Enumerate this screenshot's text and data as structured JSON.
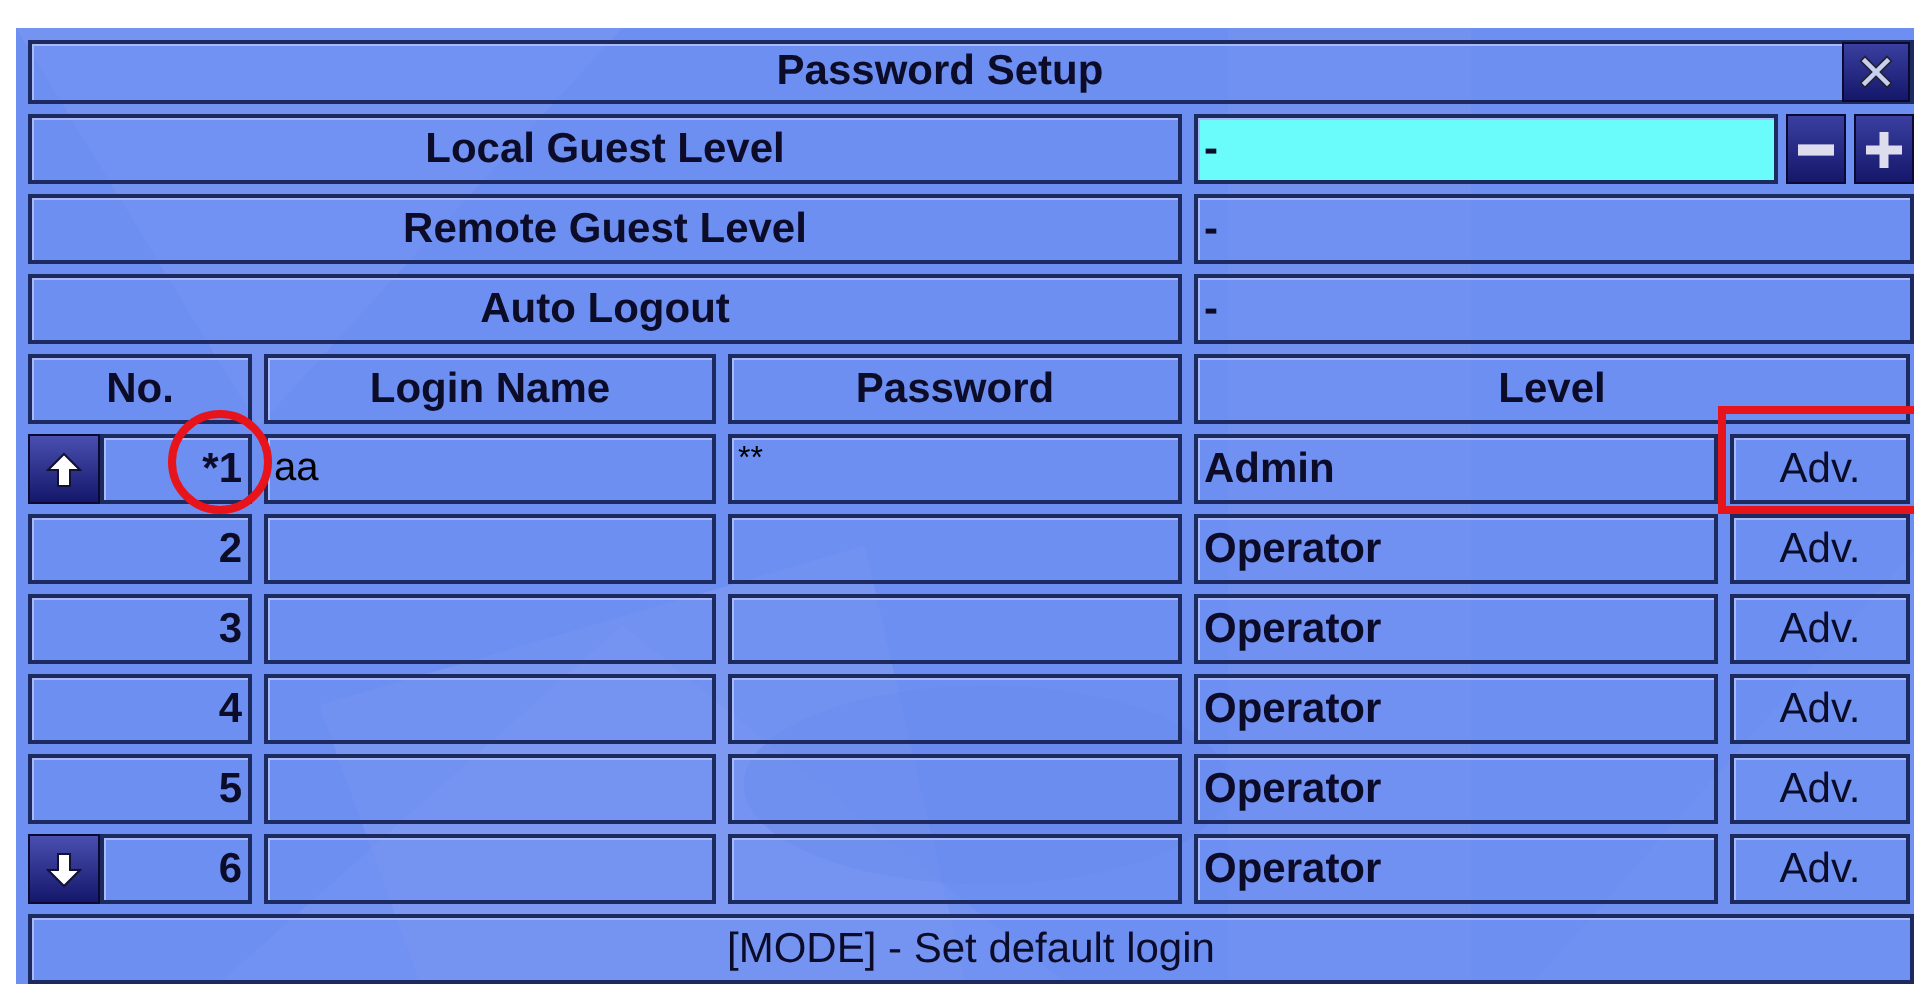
{
  "window": {
    "title": "Password Setup"
  },
  "settings": [
    {
      "label": "Local Guest Level",
      "value": "-",
      "selected": true
    },
    {
      "label": "Remote Guest Level",
      "value": "-",
      "selected": false
    },
    {
      "label": "Auto Logout",
      "value": "-",
      "selected": false
    }
  ],
  "table": {
    "columns": [
      "No.",
      "Login Name",
      "Password",
      "Level"
    ],
    "rows": [
      {
        "no": "*1",
        "login": "aa",
        "password": "**",
        "level": "Admin",
        "action": "Adv.",
        "scroll_up": true,
        "scroll_down": false,
        "annotated": true
      },
      {
        "no": "2",
        "login": "",
        "password": "",
        "level": "Operator",
        "action": "Adv.",
        "scroll_up": false,
        "scroll_down": false,
        "annotated": false
      },
      {
        "no": "3",
        "login": "",
        "password": "",
        "level": "Operator",
        "action": "Adv.",
        "scroll_up": false,
        "scroll_down": false,
        "annotated": false
      },
      {
        "no": "4",
        "login": "",
        "password": "",
        "level": "Operator",
        "action": "Adv.",
        "scroll_up": false,
        "scroll_down": false,
        "annotated": false
      },
      {
        "no": "5",
        "login": "",
        "password": "",
        "level": "Operator",
        "action": "Adv.",
        "scroll_up": false,
        "scroll_down": false,
        "annotated": false
      },
      {
        "no": "6",
        "login": "",
        "password": "",
        "level": "Operator",
        "action": "Adv.",
        "scroll_up": false,
        "scroll_down": true,
        "annotated": false
      }
    ]
  },
  "status_bar": "[MODE] - Set default login"
}
